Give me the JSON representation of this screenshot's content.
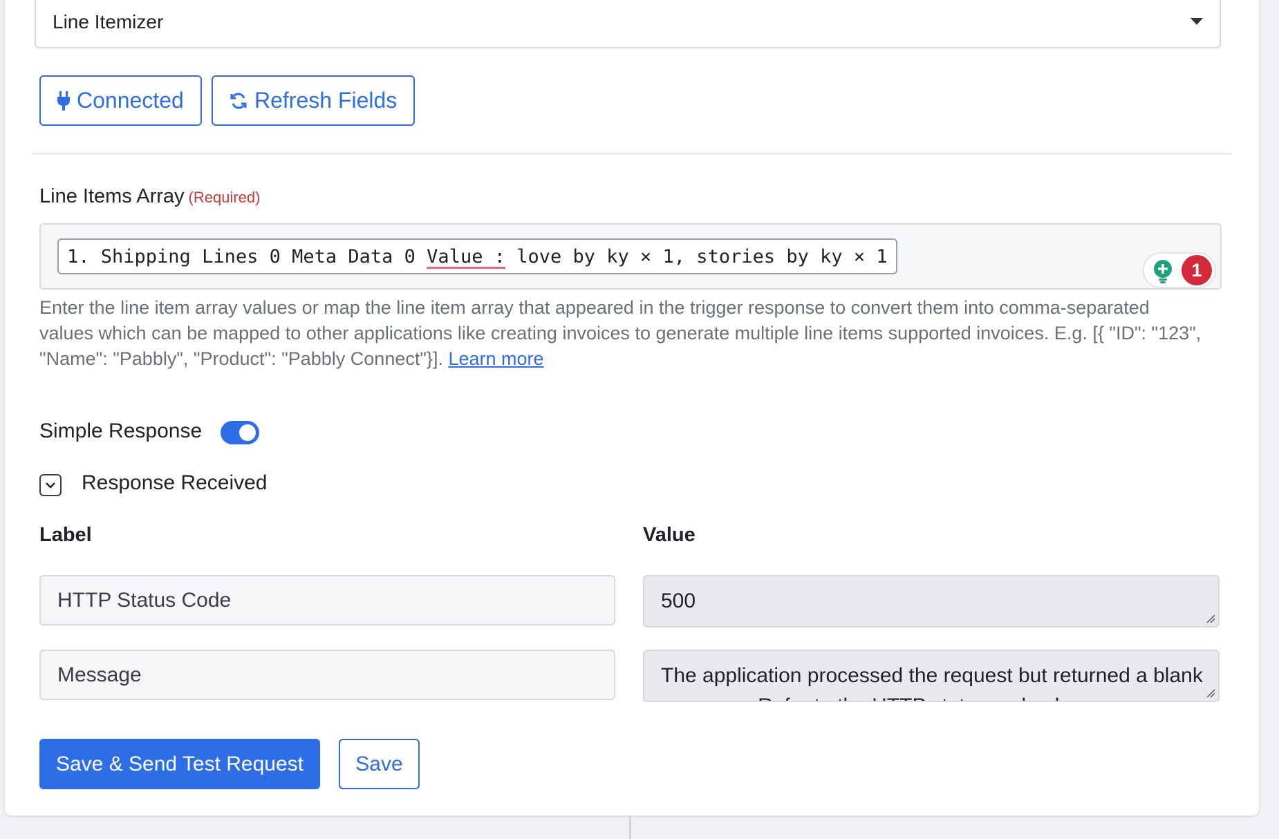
{
  "app_select": {
    "value": "Line Itemizer"
  },
  "buttons": {
    "connected": "Connected",
    "refresh": "Refresh Fields"
  },
  "line_items": {
    "label": "Line Items Array",
    "required": "(Required)",
    "chip_prefix": "1. Shipping Lines 0 Meta Data 0 ",
    "chip_underlined": "Value :",
    "chip_suffix": " love by ky × 1, stories by ky × 1",
    "badge_count": "1",
    "help_text": "Enter the line item array values or map the line item array that appeared in the trigger response to convert them into comma-separated values which can be mapped to other applications like creating invoices to generate multiple line items supported invoices. E.g. [{ \"ID\": \"123\", \"Name\": \"Pabbly\", \"Product\": \"Pabbly Connect\"}]. ",
    "learn_more": "Learn more"
  },
  "simple_response": {
    "label": "Simple Response",
    "enabled": true
  },
  "response": {
    "title": "Response Received",
    "col_label": "Label",
    "col_value": "Value",
    "rows": [
      {
        "label": "HTTP Status Code",
        "value": "500"
      },
      {
        "label": "Message",
        "value": "The application processed the request but returned a blank response. Refer to the HTTP status code above."
      }
    ]
  },
  "actions": {
    "save_test": "Save & Send Test Request",
    "save": "Save"
  },
  "colors": {
    "accent": "#2d6ee6",
    "required": "#d0393e",
    "badge": "#d22a3a"
  }
}
